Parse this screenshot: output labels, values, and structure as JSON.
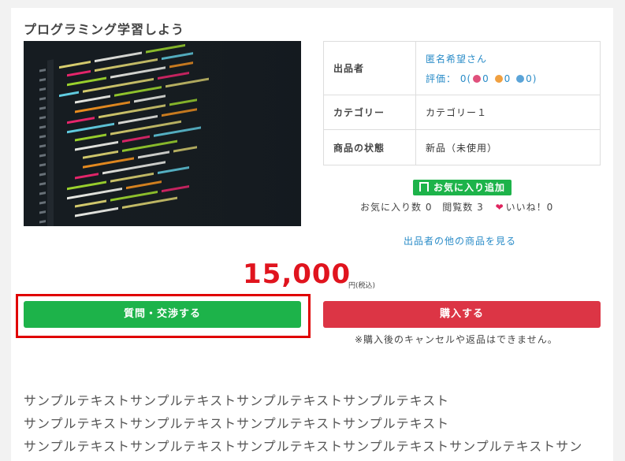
{
  "item": {
    "title": "プログラミング学習しよう",
    "price": "15,000",
    "tax_note": "円(税込)"
  },
  "info_table": {
    "seller_label": "出品者",
    "seller_name": "匿名希望さん",
    "rating_prefix": "評価：",
    "rating_total": "0(",
    "rating_good": "0",
    "rating_normal": "0",
    "rating_bad": "0",
    "rating_suffix": ")",
    "category_label": "カテゴリー",
    "category_value": "カテゴリー１",
    "condition_label": "商品の状態",
    "condition_value": "新品（未使用）"
  },
  "favorite": {
    "button_label": "お気に入り追加",
    "fav_count_text": "お気に入り数 0",
    "view_count_text": "閲覧数 3",
    "like_text": "いいね！0"
  },
  "links": {
    "other_items": "出品者の他の商品を見る"
  },
  "actions": {
    "ask_label": "質問・交渉する",
    "buy_label": "購入する",
    "buy_note": "※購入後のキャンセルや返品はできません。"
  },
  "description": {
    "lines": [
      "サンプルテキストサンプルテキストサンプルテキストサンプルテキスト",
      "サンプルテキストサンプルテキストサンプルテキストサンプルテキスト",
      "サンプルテキストサンプルテキストサンプルテキストサンプルテキストサンプルテキストサン"
    ]
  },
  "colors": {
    "accent_green": "#1db34a",
    "danger_red": "#dc3545",
    "price_red": "#e0141e",
    "link_blue": "#2a8cc8",
    "highlight_red": "#e00000"
  },
  "icons": {
    "favorite": "bookmark-icon",
    "like": "heart-icon",
    "rating_good": "smile-face-icon",
    "rating_normal": "neutral-face-icon",
    "rating_bad": "sad-face-icon"
  }
}
